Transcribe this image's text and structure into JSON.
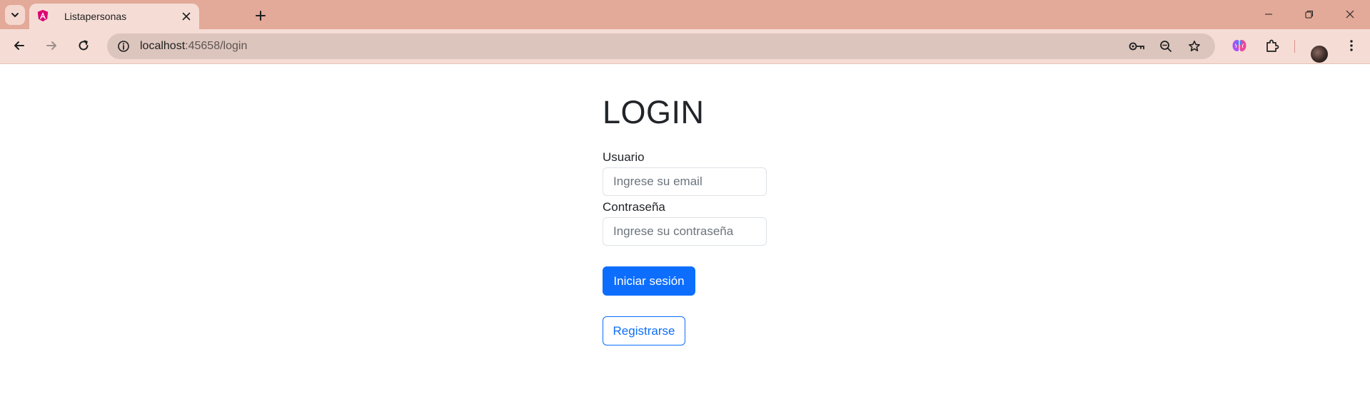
{
  "browser": {
    "tab": {
      "title": "Listapersonas"
    },
    "address_bar": {
      "host": "localhost",
      "path": ":45658/login"
    }
  },
  "page": {
    "title": "LOGIN",
    "username": {
      "label": "Usuario",
      "placeholder": "Ingrese su email",
      "value": ""
    },
    "password": {
      "label": "Contraseña",
      "placeholder": "Ingrese su contraseña",
      "value": ""
    },
    "login_button": "Iniciar sesión",
    "register_button": "Registrarse"
  },
  "colors": {
    "tabstrip": "#e3a999",
    "toolbar": "#f5ddd6",
    "omnibox": "#dcc5bd",
    "primary": "#0d6efd",
    "text": "#212529"
  }
}
